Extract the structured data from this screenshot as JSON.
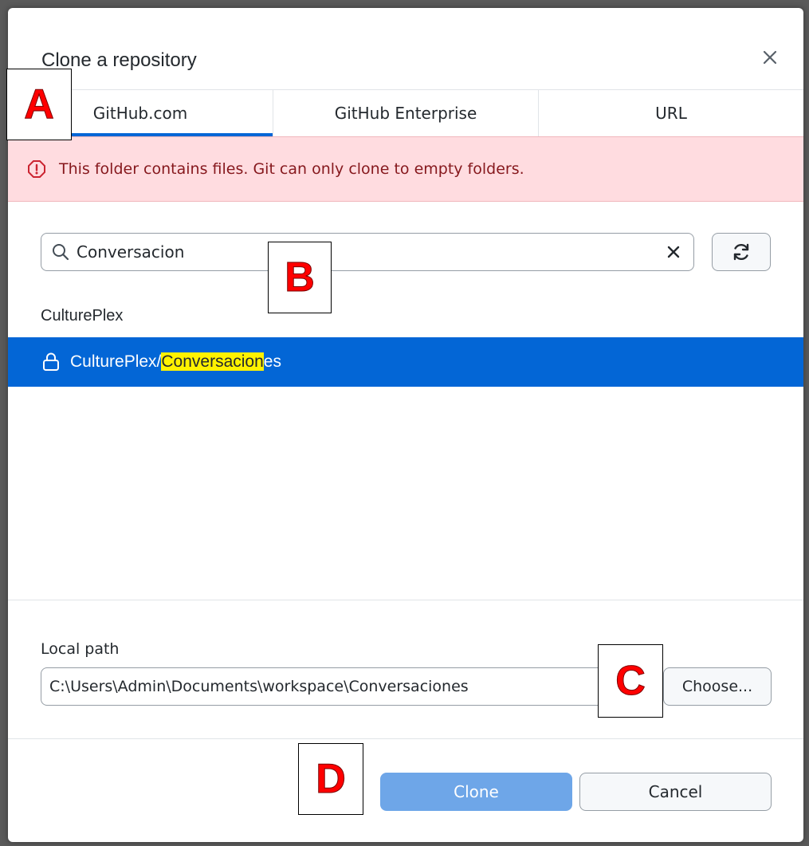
{
  "dialog": {
    "title": "Clone a repository"
  },
  "tabs": [
    {
      "label": "GitHub.com",
      "selected": true
    },
    {
      "label": "GitHub Enterprise",
      "selected": false
    },
    {
      "label": "URL",
      "selected": false
    }
  ],
  "error_banner": {
    "message": "This folder contains files. Git can only clone to empty folders.",
    "icon": "alert-circle-icon"
  },
  "search": {
    "value": "Conversacion",
    "icon": "search-icon"
  },
  "repo_list": {
    "group": "CulturePlex",
    "items": [
      {
        "prefix": "CulturePlex/",
        "match": "Conversacion",
        "suffix": "es",
        "private": true,
        "selected": true
      }
    ]
  },
  "local_path": {
    "label": "Local path",
    "value": "C:\\Users\\Admin\\Documents\\workspace\\Conversaciones",
    "choose_label": "Choose..."
  },
  "footer": {
    "clone_label": "Clone",
    "cancel_label": "Cancel"
  },
  "markers": {
    "a": "A",
    "b": "B",
    "c": "C",
    "d": "D"
  },
  "colors": {
    "accent": "#0366d6",
    "error_bg": "#ffdce0",
    "error_text": "#86181d",
    "highlight": "#fff200",
    "marker": "#ff0000"
  }
}
